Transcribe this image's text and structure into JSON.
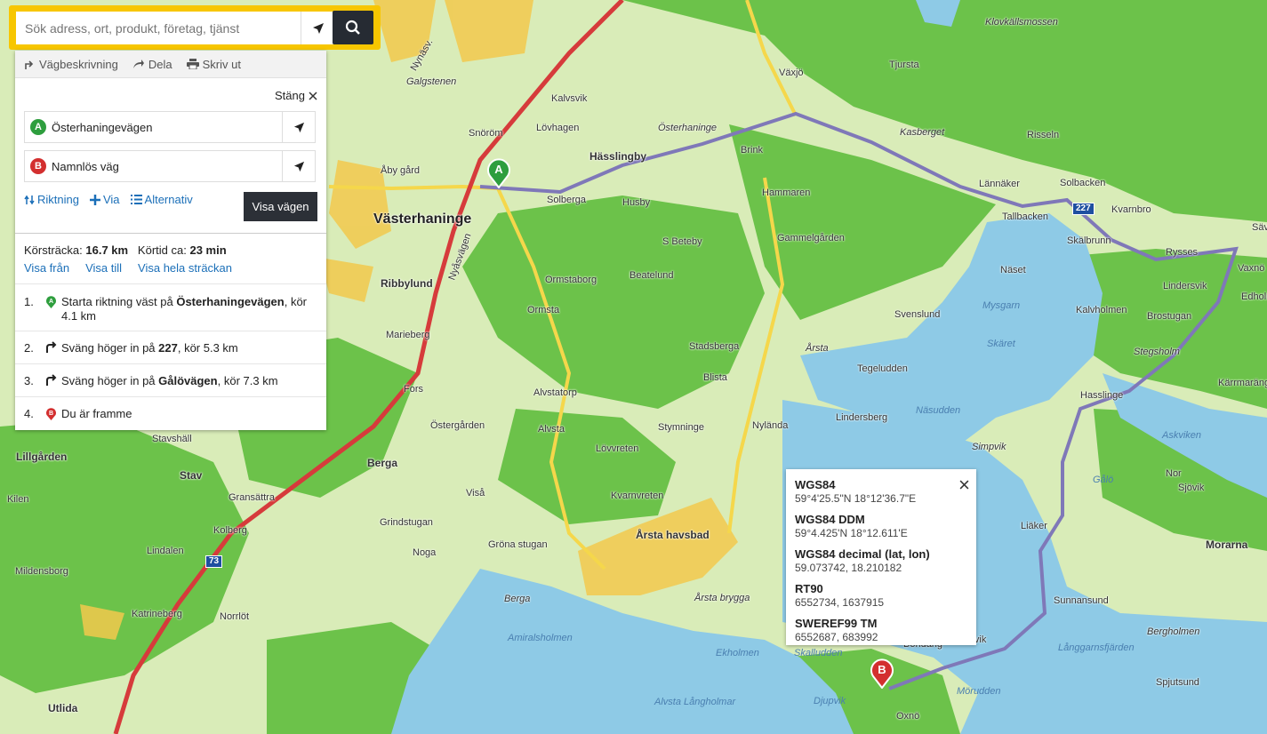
{
  "search": {
    "placeholder": "Sök adress, ort, produkt, företag, tjänst"
  },
  "toolbar": {
    "directions_label": "Vägbeskrivning",
    "share_label": "Dela",
    "print_label": "Skriv ut"
  },
  "panel": {
    "close_label": "Stäng",
    "waypoint_a": {
      "marker": "A",
      "label": "Österhaningevägen"
    },
    "waypoint_b": {
      "marker": "B",
      "label": "Namnlös väg"
    },
    "options": {
      "direction_label": "Riktning",
      "via_label": "Via",
      "alternative_label": "Alternativ"
    },
    "show_route_label": "Visa vägen"
  },
  "summary": {
    "distance_label": "Körsträcka:",
    "distance_value": "16.7 km",
    "time_label": "Körtid ca:",
    "time_value": "23 min",
    "show_from": "Visa från",
    "show_to": "Visa till",
    "show_whole": "Visa hela sträckan"
  },
  "steps": [
    {
      "num": "1.",
      "pre": "Starta riktning väst på ",
      "road": "Österhaningevägen",
      "post": ", kör 4.1 km",
      "icon": "marker-a-icon"
    },
    {
      "num": "2.",
      "pre": "Sväng höger in på ",
      "road": "227",
      "post": ", kör 5.3 km",
      "icon": "turn-right-icon"
    },
    {
      "num": "3.",
      "pre": "Sväng höger in på ",
      "road": "Gålövägen",
      "post": ", kör 7.3 km",
      "icon": "turn-right-icon"
    },
    {
      "num": "4.",
      "pre": "Du är framme",
      "road": "",
      "post": "",
      "icon": "marker-b-icon"
    }
  ],
  "coordinates": [
    {
      "title": "WGS84",
      "value": "59°4'25.5\"N 18°12'36.7\"E"
    },
    {
      "title": "WGS84 DDM",
      "value": "59°4.425'N 18°12.611'E"
    },
    {
      "title": "WGS84 decimal (lat, lon)",
      "value": "59.073742, 18.210182"
    },
    {
      "title": "RT90",
      "value": "6552734, 1637915"
    },
    {
      "title": "SWEREF99 TM",
      "value": "6552687, 683992"
    }
  ],
  "map": {
    "markers": {
      "a": "A",
      "b": "B"
    },
    "road_shields": [
      "227",
      "73"
    ],
    "place_labels": [
      "Västerhaninge",
      "Årsta havsbad",
      "Ribbylund",
      "Berga",
      "Stav",
      "Lillgården",
      "Utlida",
      "Hässlingby",
      "Växjö",
      "Tjursta",
      "Klovkällsmossen",
      "Kasberget",
      "Risseln",
      "Lännäker",
      "Solbacken",
      "Tallbacken",
      "Kvarnbro",
      "Skälbrunn",
      "Rysses",
      "Lindersvik",
      "Näset",
      "Brostugan",
      "Kalvholmen",
      "Stegsholm",
      "Hasslinge",
      "Kärrmaräng",
      "Svenslund",
      "Tegeludden",
      "Lindersberg",
      "Nyländа",
      "Stymninge",
      "Blista",
      "Stadsberga",
      "Årsta",
      "Brink",
      "Hammaren",
      "Gammelgården",
      "S Beteby",
      "Beatelund",
      "Ormstaborg",
      "Ormsta",
      "Alvstatorp",
      "Alvsta",
      "Lövvreten",
      "Kvarnvreten",
      "Östergården",
      "Fors",
      "Marieberg",
      "Solberga",
      "Husby",
      "Lövhagen",
      "Kalvsvik",
      "Snöröm",
      "Åby gård",
      "Galgstenen",
      "Österhaninge",
      "Stavshäll",
      "Kilen",
      "Mildensborg",
      "Kolberg",
      "Lindalen",
      "Gransättra",
      "Katrineberg",
      "Norrlöt",
      "Noga",
      "Grindstugan",
      "Gröna stugan",
      "Viså",
      "Berga",
      "Amiralsholmen",
      "Ekholmen",
      "Skalludden",
      "Bondang",
      "Oxnö",
      "Djupvik",
      "Alvsta Långholmar",
      "Årsta brygga",
      "Spjutsund",
      "Bergholmen",
      "Sunnansund",
      "Liäker",
      "Sjövik",
      "Nor",
      "Morarna",
      "Ålövik",
      "Mörudden",
      "Vaxnö",
      "Edholm",
      "Sävik",
      "Simpvik",
      "Näsudden",
      "Mysgarn",
      "Skäret",
      "Gålö",
      "Askviken",
      "Långgarnsfjärden",
      "Nynäsv.",
      "Nyåsvägen"
    ]
  }
}
